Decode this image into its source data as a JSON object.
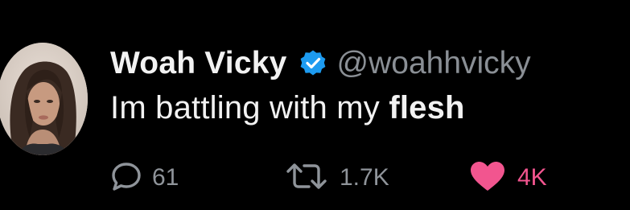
{
  "tweet": {
    "author": {
      "display_name": "Woah Vicky",
      "handle": "@woahhvicky",
      "verified": true
    },
    "text": {
      "regular": "Im battling with my ",
      "bold": "flesh"
    },
    "actions": {
      "replies": "61",
      "retweets": "1.7K",
      "likes": "4K"
    }
  },
  "icons": {
    "reply": "speech-bubble-icon",
    "retweet": "retweet-arrows-icon",
    "like": "heart-icon",
    "verified": "verified-badge-icon"
  },
  "colors": {
    "background": "#000000",
    "text_primary": "#f2f2f2",
    "text_secondary": "#8a8f95",
    "verified_blue": "#1d9bf0",
    "like_pink": "#f2558f"
  }
}
